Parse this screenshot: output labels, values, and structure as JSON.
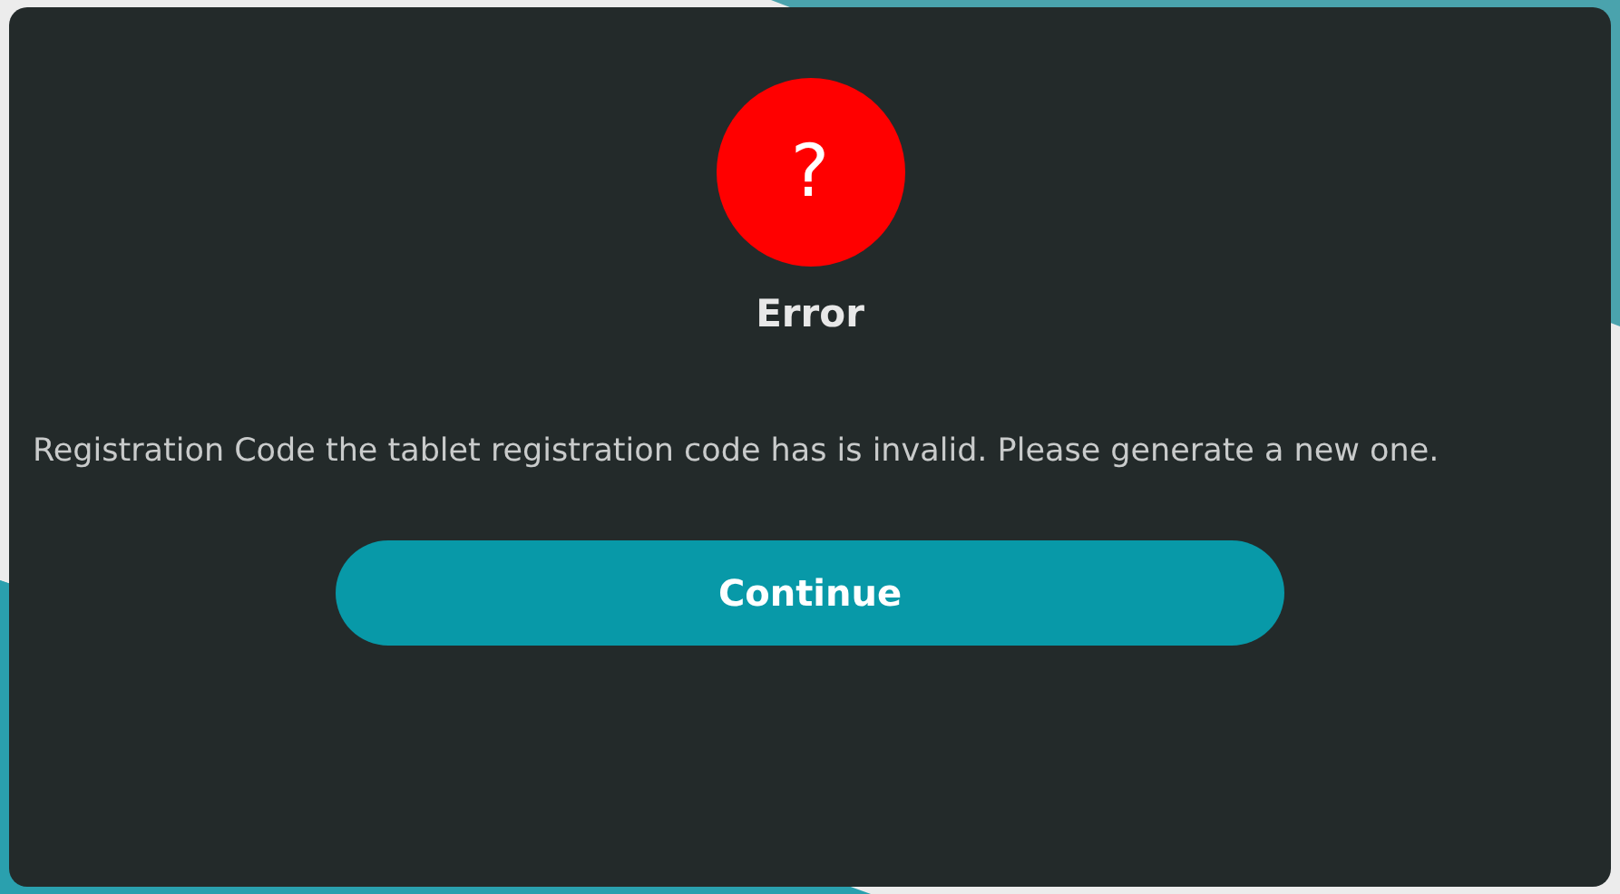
{
  "dialog": {
    "icon": "?",
    "title": "Error",
    "message": " Registration Code the tablet registration code has is invalid. Please generate a new one.",
    "buttons": [
      "Continue"
    ]
  }
}
